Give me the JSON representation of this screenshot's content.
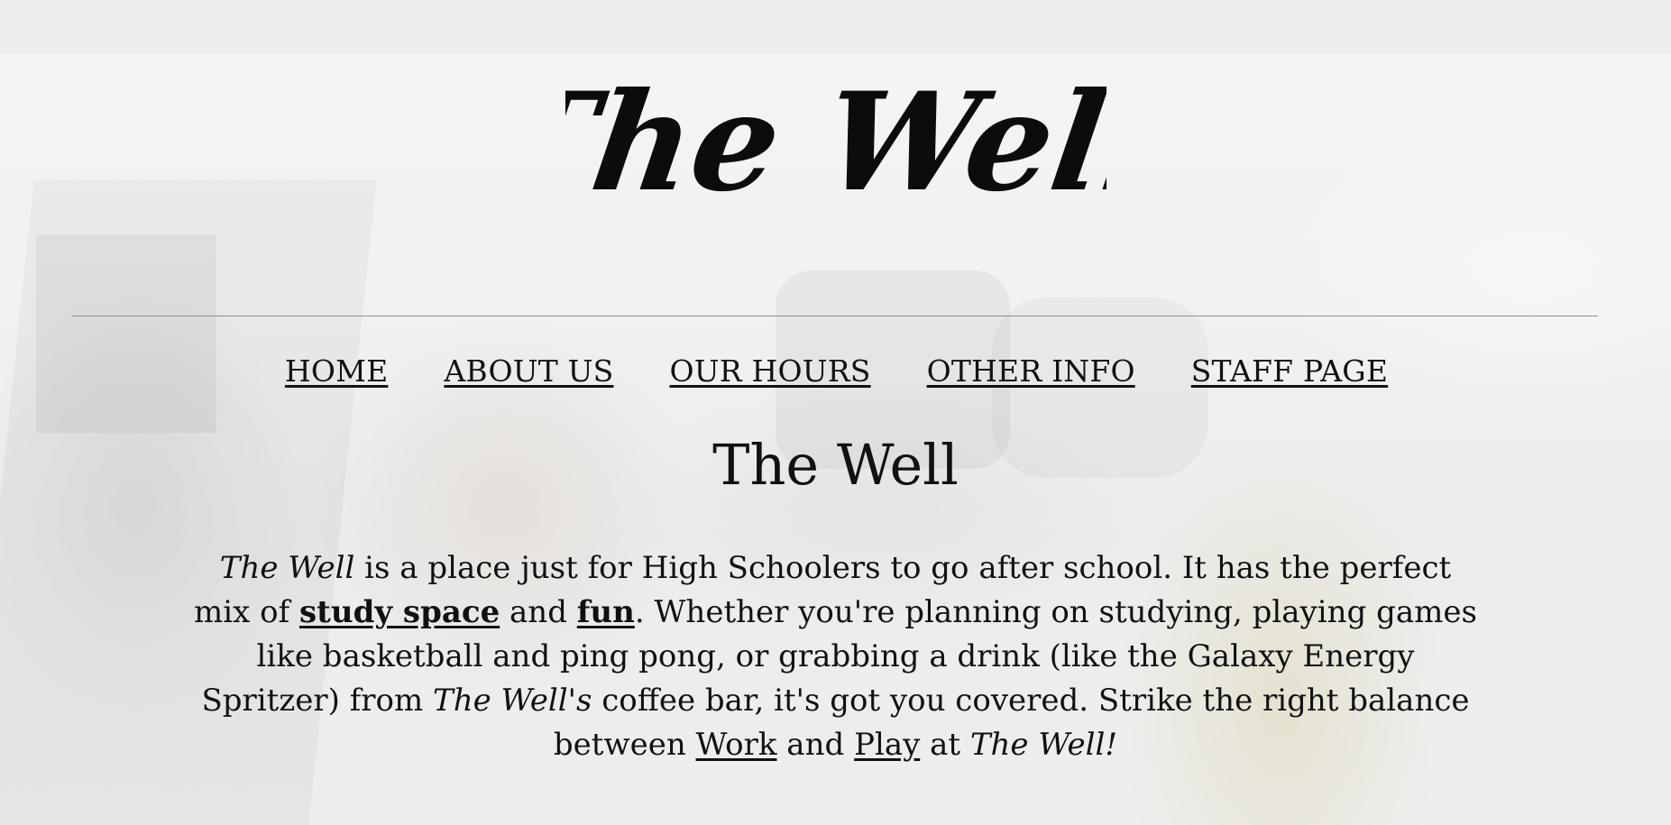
{
  "logo": {
    "text": "The Well"
  },
  "nav": {
    "items": [
      {
        "label": "HOME"
      },
      {
        "label": "ABOUT US"
      },
      {
        "label": "OUR HOURS"
      },
      {
        "label": "OTHER INFO"
      },
      {
        "label": "STAFF PAGE"
      }
    ]
  },
  "main": {
    "heading": "The Well",
    "intro": {
      "brand": "The Well",
      "part1": " is a place just for High Schoolers to go after school. It has the perfect mix of ",
      "link_study": "study space",
      "part2": " and ",
      "link_fun": "fun",
      "part3": ". Whether you're planning on studying, playing games like basketball and ping pong, or grabbing a drink (like the Galaxy Energy Spritzer) from ",
      "brand_possessive": "The Well's",
      "part4": " coffee bar, it's got you covered. Strike the right balance between ",
      "link_work": "Work",
      "part5": " and ",
      "link_play": "Play",
      "part6": " at ",
      "brand_end": "The Well!"
    }
  },
  "colors": {
    "text": "#111111",
    "divider": "#8f8f8f"
  }
}
